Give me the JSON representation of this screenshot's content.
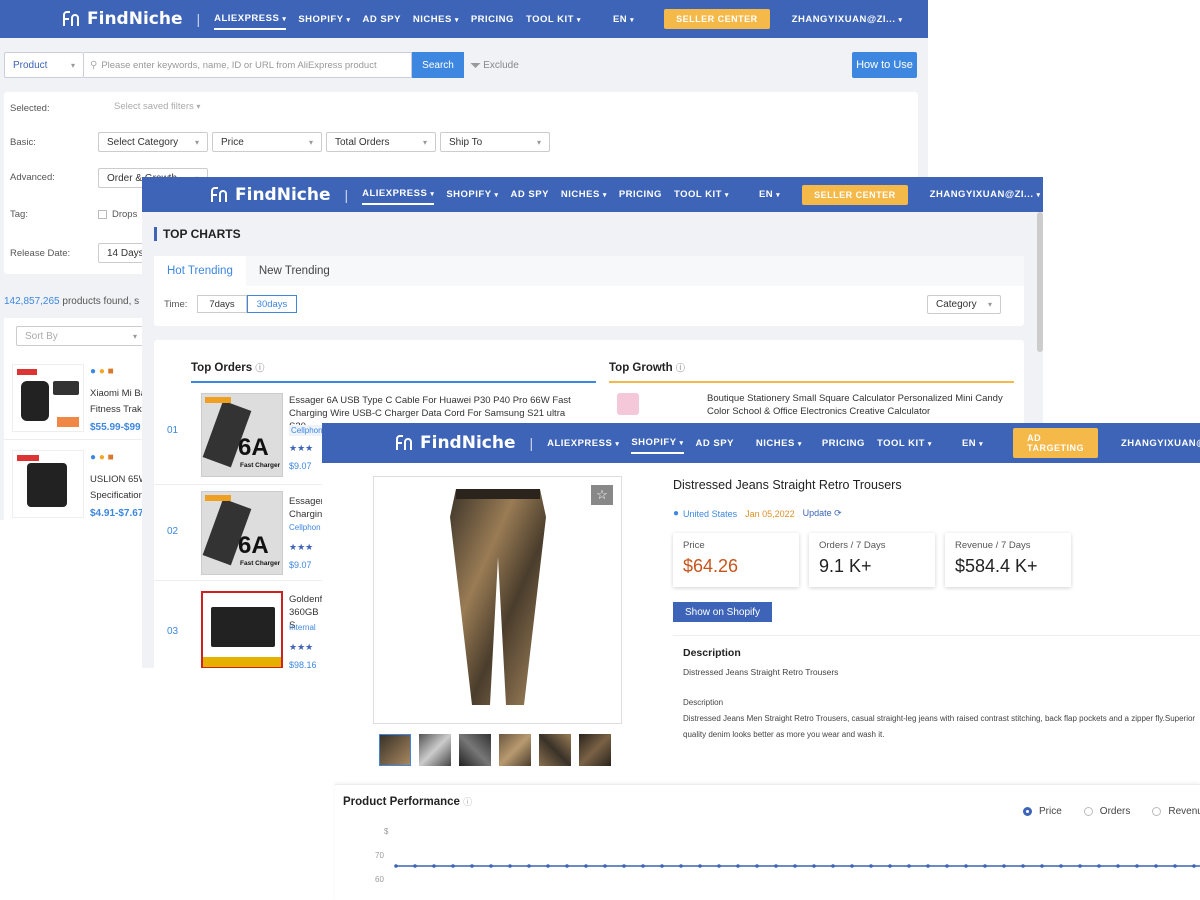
{
  "nav": {
    "logo_text": "FindNiche",
    "items": [
      "ALIEXPRESS",
      "SHOPIFY",
      "AD SPY",
      "NICHES",
      "PRICING",
      "TOOL KIT"
    ],
    "lang": "EN",
    "seller_center": "SELLER CENTER",
    "ad_targeting": "AD TARGETING",
    "user": "ZHANGYIXUAN@ZI..."
  },
  "search": {
    "type_select": "Product",
    "placeholder": "Please enter keywords, name, ID or URL from AliExpress product",
    "button": "Search",
    "exclude": "Exclude",
    "how_to_use": "How to Use"
  },
  "filters": {
    "selected_label": "Selected:",
    "saved_filters": "Select saved filters",
    "basic_label": "Basic:",
    "basic": [
      "Select Category",
      "Price",
      "Total Orders",
      "Ship To"
    ],
    "advanced_label": "Advanced:",
    "advanced_first": "Order & Growth",
    "tag_label": "Tag:",
    "tag_value": "Drops",
    "release_label": "Release Date:",
    "release_value": "14 Days"
  },
  "results": {
    "count": "142,857,265",
    "text": "products found, s",
    "sort_by": "Sort By",
    "items": [
      {
        "title_line1": "Xiaomi Mi Ba",
        "title_line2": "Fitness Trake",
        "price": "$55.99-$99"
      },
      {
        "title_line1": "USLION 65W",
        "title_line2": "Specification",
        "price": "$4.91-$7.67"
      }
    ]
  },
  "top_charts": {
    "heading": "TOP CHARTS",
    "tabs": [
      "Hot Trending",
      "New Trending"
    ],
    "time_label": "Time:",
    "time_options": [
      "7days",
      "30days"
    ],
    "category": "Category",
    "top_orders": "Top Orders",
    "top_growth": "Top Growth",
    "rows": [
      {
        "rank": "01",
        "title": "Essager 6A USB Type C Cable For Huawei P30 P40 Pro 66W Fast Charging Wire USB-C Charger Data Cord For Samsung S21 ultra S20...",
        "tag": "Cellphon",
        "price": "$9.07"
      },
      {
        "rank": "02",
        "title": "Essager Chargin",
        "tag": "Cellphon",
        "price": "$9.07"
      },
      {
        "rank": "03",
        "title": "Goldenf 360GB S",
        "tag": "Internal",
        "price": "$98.16"
      }
    ],
    "growth_title": "Boutique Stationery Small Square Calculator Personalized Mini Candy Color School & Office Electronics Creative Calculator",
    "cable_badge": "6A",
    "cable_sub": "Fast Charger"
  },
  "product": {
    "title": "Distressed Jeans Straight Retro Trousers",
    "country": "United States",
    "date": "Jan 05,2022",
    "update": "Update",
    "stats": [
      {
        "label": "Price",
        "value": "$64.26"
      },
      {
        "label": "Orders / 7 Days",
        "value": "9.1 K+"
      },
      {
        "label": "Revenue / 7 Days",
        "value": "$584.4 K+"
      }
    ],
    "show_button": "Show on Shopify",
    "desc_heading": "Description",
    "desc_line1": "Distressed Jeans Straight Retro Trousers",
    "desc_sub": "Description",
    "desc_body": "Distressed Jeans Men Straight Retro Trousers, casual straight-leg jeans with raised contrast stitching, back flap pockets and a zipper fly.Superior quality denim looks better as more you wear and wash it.",
    "performance_heading": "Product Performance",
    "radio": [
      "Price",
      "Orders",
      "Revenue"
    ],
    "axis": {
      "unit": "$",
      "ticks": [
        "70",
        "60"
      ]
    },
    "colors": {
      "accent": "#3d64b6",
      "orange": "#f5b94a",
      "price": "#c8541c"
    }
  }
}
